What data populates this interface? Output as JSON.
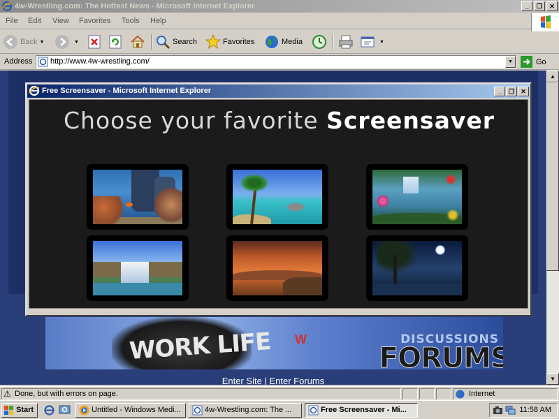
{
  "window": {
    "title": "4w-Wrestling.com: The Hottest News - Microsoft Internet Explorer",
    "controls": {
      "minimize": "_",
      "maximize": "❐",
      "close": "✕"
    }
  },
  "menu": [
    "File",
    "Edit",
    "View",
    "Favorites",
    "Tools",
    "Help"
  ],
  "toolbar": {
    "back": "Back",
    "search": "Search",
    "favorites": "Favorites",
    "media": "Media"
  },
  "address": {
    "label": "Address",
    "url": "http://www.4w-wrestling.com/",
    "go": "Go"
  },
  "page": {
    "banner": {
      "word": "WORK LIFE",
      "discussions": "DISCUSSIONS",
      "forums": "FORUMS"
    },
    "links": {
      "enter_site": "Enter Site",
      "separator": "|",
      "enter_forums": "Enter Forums"
    }
  },
  "popup": {
    "title": "Free Screensaver - Microsoft Internet Explorer",
    "heading_prefix": "Choose your favorite",
    "heading_bold": "Screensaver",
    "thumbnails": [
      {
        "name": "aquarium"
      },
      {
        "name": "tropical-beach"
      },
      {
        "name": "garden-pond"
      },
      {
        "name": "waterfall"
      },
      {
        "name": "desert-sunset"
      },
      {
        "name": "night-lake"
      }
    ]
  },
  "status": {
    "text": "Done, but with errors on page.",
    "zone": "Internet"
  },
  "taskbar": {
    "start": "Start",
    "tasks": [
      {
        "label": "Untitled - Windows Medi...",
        "active": false
      },
      {
        "label": "4w-Wrestling.com: The ...",
        "active": false
      },
      {
        "label": "Free Screensaver - Mi...",
        "active": true
      }
    ],
    "clock": "11:58 AM"
  }
}
